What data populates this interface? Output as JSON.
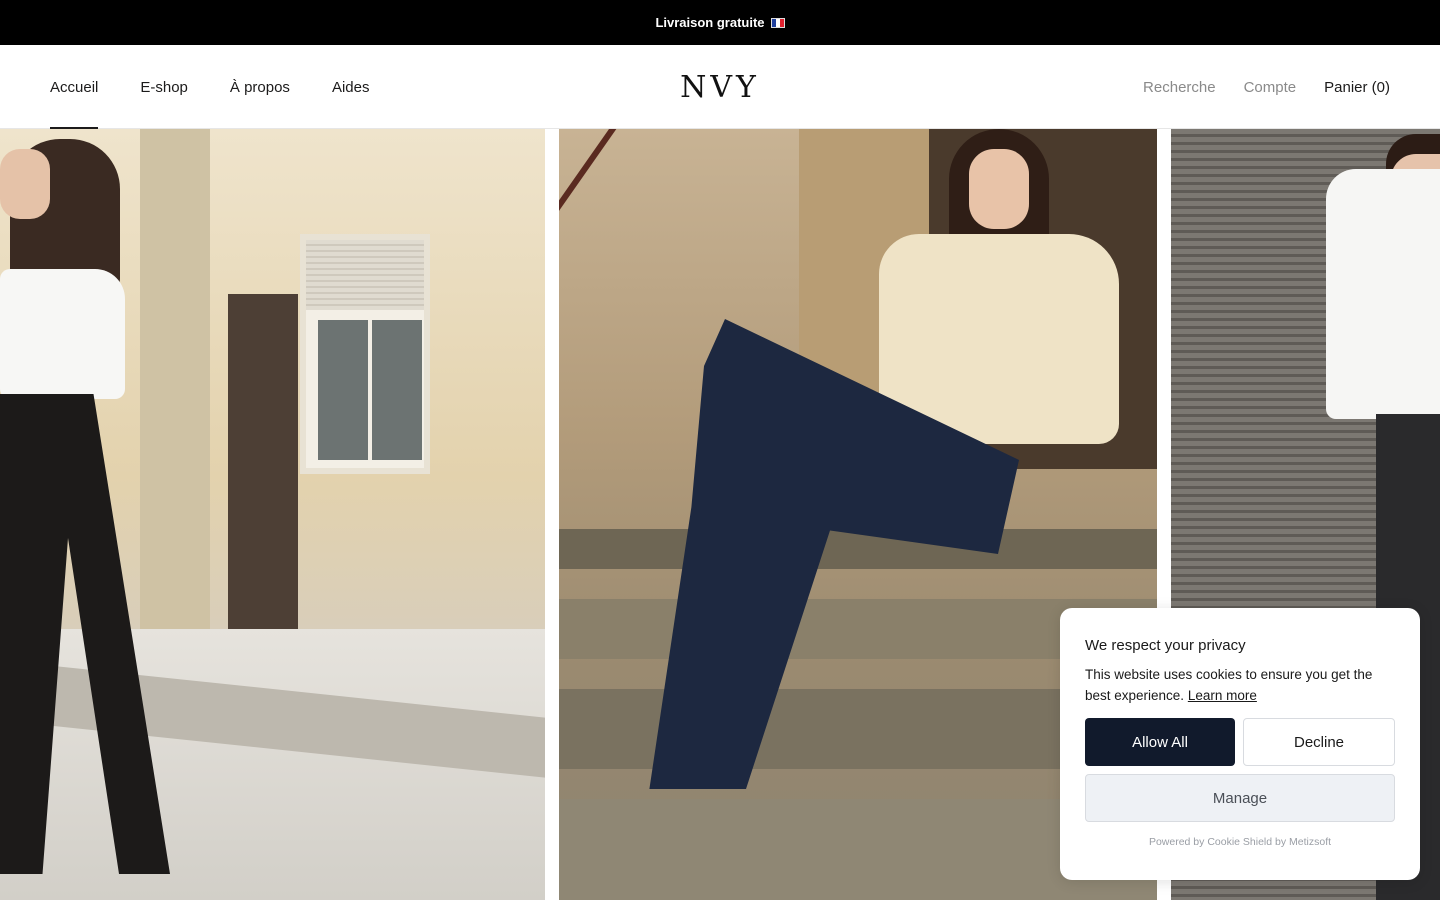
{
  "announcement": {
    "text": "Livraison gratuite",
    "flag": "france-flag"
  },
  "header": {
    "nav_left": [
      {
        "label": "Accueil",
        "active": true
      },
      {
        "label": "E-shop"
      },
      {
        "label": "À propos"
      },
      {
        "label": "Aides"
      }
    ],
    "logo": "NVY",
    "search_label": "Recherche",
    "account_label": "Compte",
    "cart_label": "Panier",
    "cart_count": "(0)"
  },
  "cookie_banner": {
    "title": "We respect your privacy",
    "body": "This website uses cookies to ensure you get the best experience.",
    "learn_more": "Learn more",
    "allow_all": "Allow All",
    "decline": "Decline",
    "manage": "Manage",
    "powered_by": "Powered by Cookie Shield by Metizsoft"
  },
  "colors": {
    "announcement_bg": "#000000",
    "primary_button": "#111a2c",
    "text": "#1c1b1b",
    "muted_nav": "#8a8a8a"
  }
}
